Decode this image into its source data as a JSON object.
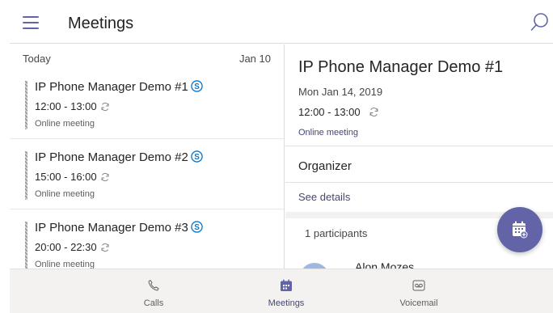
{
  "header": {
    "title": "Meetings",
    "menu_icon": "hamburger-menu-icon",
    "search_icon": "search-icon"
  },
  "list": {
    "section_label": "Today",
    "section_date": "Jan 10",
    "items": [
      {
        "title": "IP Phone Manager Demo #1",
        "time": "12:00 - 13:00",
        "type": "Online meeting"
      },
      {
        "title": "IP Phone Manager Demo #2",
        "time": "15:00 - 16:00",
        "type": "Online meeting"
      },
      {
        "title": "IP Phone Manager Demo #3",
        "time": "20:00 - 22:30",
        "type": "Online meeting"
      }
    ]
  },
  "detail": {
    "title": "IP Phone Manager Demo #1",
    "date": "Mon Jan 14, 2019",
    "time": "12:00 - 13:00",
    "type": "Online meeting",
    "organizer_label": "Organizer",
    "see_details": "See details",
    "participants": "1 participants",
    "participant_name": "Alon Mozes"
  },
  "nav": {
    "items": [
      {
        "label": "Calls",
        "icon": "phone-icon"
      },
      {
        "label": "Meetings",
        "icon": "calendar-icon",
        "active": true
      },
      {
        "label": "Voicemail",
        "icon": "voicemail-icon"
      }
    ]
  },
  "colors": {
    "accent": "#6264a7",
    "link": "#464775",
    "skype": "#0078d4"
  }
}
